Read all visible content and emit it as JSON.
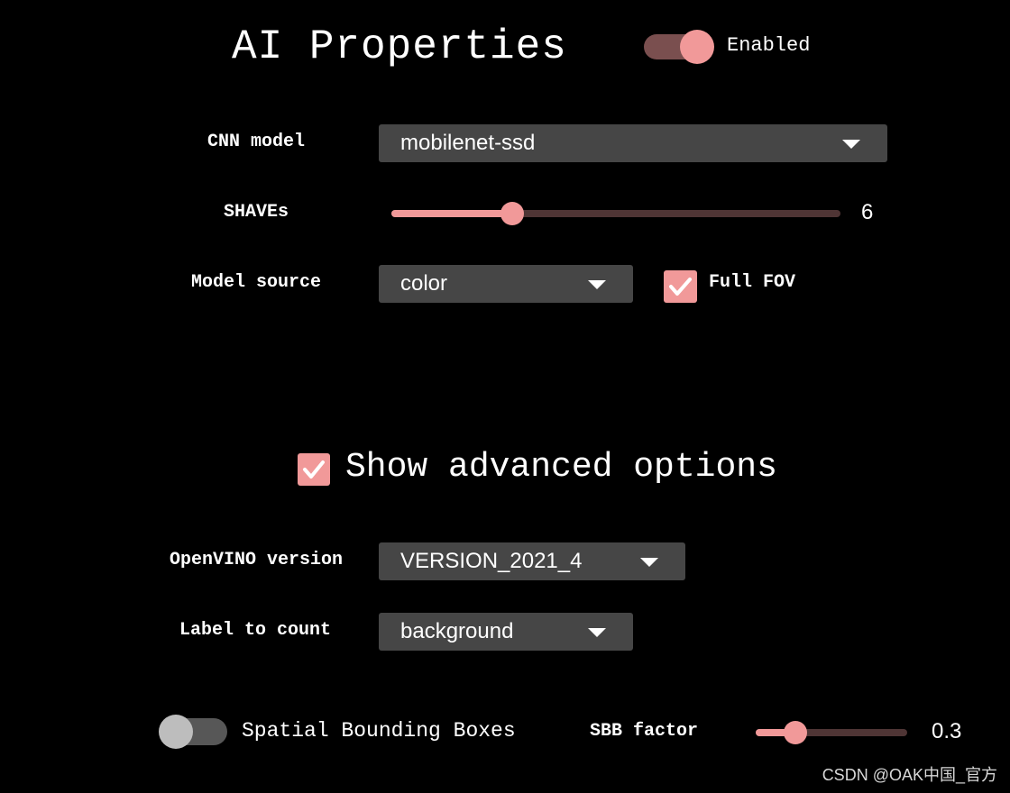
{
  "header": {
    "title": "AI Properties",
    "enabled_label": "Enabled",
    "enabled_on": true
  },
  "cnn_model": {
    "label": "CNN model",
    "value": "mobilenet-ssd"
  },
  "shaves": {
    "label": "SHAVEs",
    "value": "6",
    "level": 0.27
  },
  "model_source": {
    "label": "Model source",
    "value": "color",
    "full_fov_label": "Full FOV",
    "full_fov_checked": true
  },
  "advanced": {
    "label": "Show advanced options",
    "checked": true
  },
  "openvino": {
    "label": "OpenVINO version",
    "value": "VERSION_2021_4"
  },
  "label_count": {
    "label": "Label to count",
    "value": "background"
  },
  "spatial": {
    "label": "Spatial Bounding Boxes",
    "on": false
  },
  "sbb": {
    "label": "SBB factor",
    "value": "0.3",
    "level": 0.26
  },
  "watermark": "CSDN @OAK中国_官方",
  "colors": {
    "accent": "#f19999",
    "track_dim": "#4f3535",
    "select_bg": "#464646",
    "bg": "#000000"
  }
}
